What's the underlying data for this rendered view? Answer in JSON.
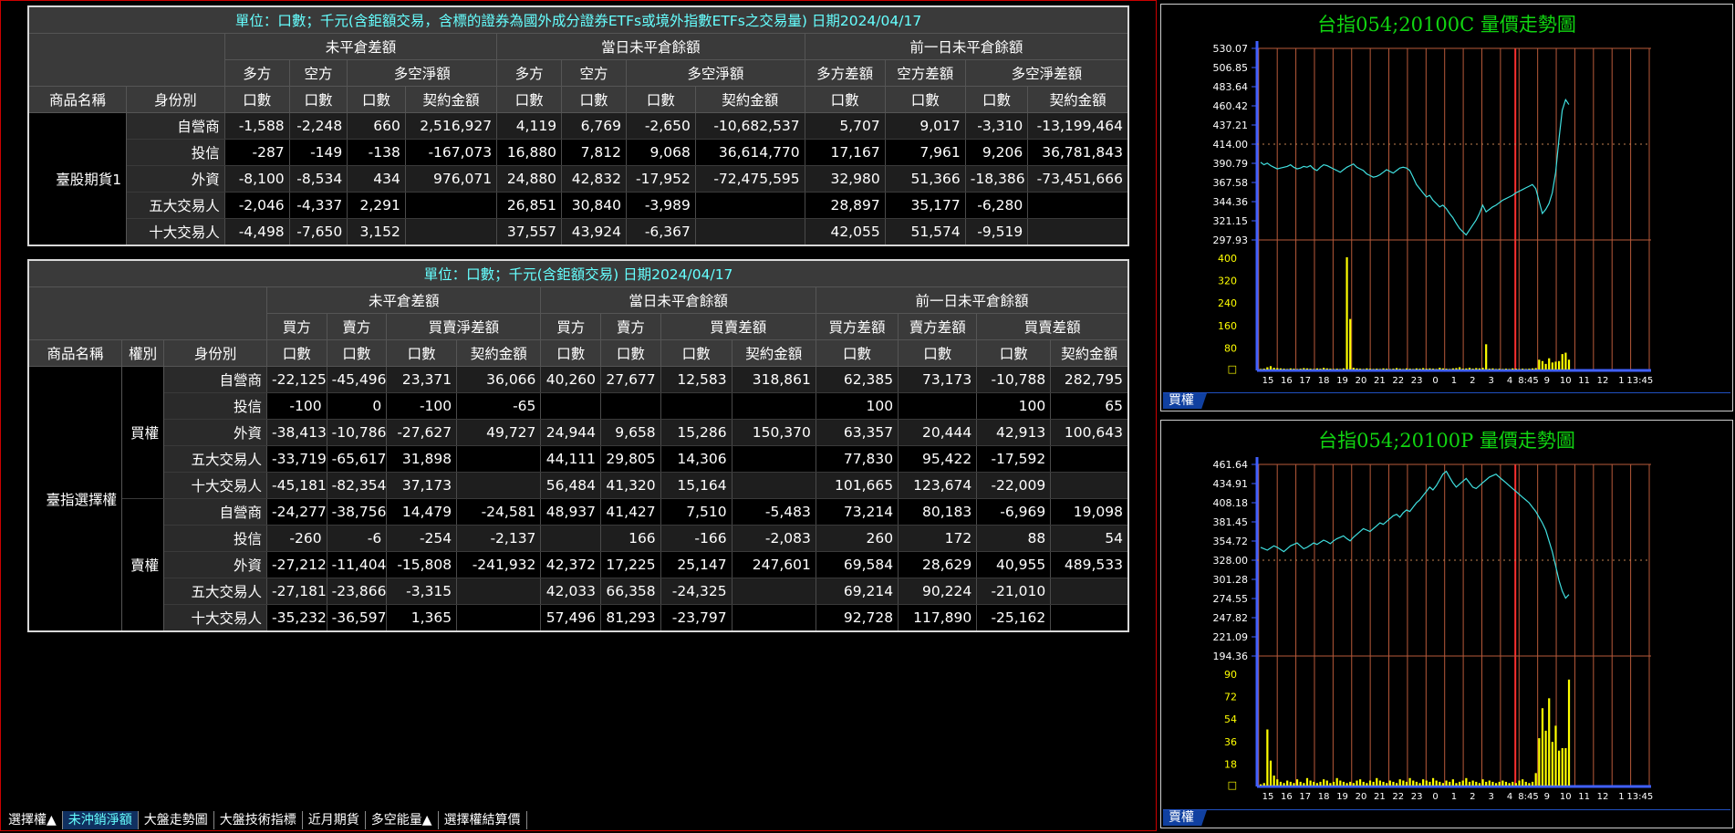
{
  "table1": {
    "title": "單位：口數；千元(含鉅額交易，含標的證券為國外成分證券ETFs或境外指數ETFs之交易量) 日期2024/04/17",
    "group_headers": [
      "未平倉差額",
      "當日未平倉餘額",
      "前一日未平倉餘額"
    ],
    "sub_headers": [
      "多方",
      "空方",
      "多空淨額",
      "多方",
      "空方",
      "多空淨額",
      "多方差額",
      "空方差額",
      "多空淨差額"
    ],
    "col_headers": [
      "商品名稱",
      "身份別",
      "口數",
      "口數",
      "口數",
      "契約金額",
      "口數",
      "口數",
      "口數",
      "契約金額",
      "口數",
      "口數",
      "口數",
      "契約金額"
    ],
    "product": "臺股期貨1",
    "rows": [
      {
        "id": "自營商",
        "v": [
          "-1,588",
          "-2,248",
          "660",
          "2,516,927",
          "4,119",
          "6,769",
          "-2,650",
          "-10,682,537",
          "5,707",
          "9,017",
          "-3,310",
          "-13,199,464"
        ]
      },
      {
        "id": "投信",
        "v": [
          "-287",
          "-149",
          "-138",
          "-167,073",
          "16,880",
          "7,812",
          "9,068",
          "36,614,770",
          "17,167",
          "7,961",
          "9,206",
          "36,781,843"
        ]
      },
      {
        "id": "外資",
        "v": [
          "-8,100",
          "-8,534",
          "434",
          "976,071",
          "24,880",
          "42,832",
          "-17,952",
          "-72,475,595",
          "32,980",
          "51,366",
          "-18,386",
          "-73,451,666"
        ]
      },
      {
        "id": "五大交易人",
        "v": [
          "-2,046",
          "-4,337",
          "2,291",
          "",
          "26,851",
          "30,840",
          "-3,989",
          "",
          "28,897",
          "35,177",
          "-6,280",
          ""
        ]
      },
      {
        "id": "十大交易人",
        "v": [
          "-4,498",
          "-7,650",
          "3,152",
          "",
          "37,557",
          "43,924",
          "-6,367",
          "",
          "42,055",
          "51,574",
          "-9,519",
          ""
        ]
      }
    ]
  },
  "table2": {
    "title": "單位：口數；千元(含鉅額交易) 日期2024/04/17",
    "group_headers": [
      "未平倉差額",
      "當日未平倉餘額",
      "前一日未平倉餘額"
    ],
    "sub_headers": [
      "買方",
      "賣方",
      "買賣淨差額",
      "買方",
      "賣方",
      "買賣差額",
      "買方差額",
      "賣方差額",
      "買賣差額"
    ],
    "col_headers": [
      "商品名稱",
      "權別",
      "身份別",
      "口數",
      "口數",
      "口數",
      "契約金額",
      "口數",
      "口數",
      "口數",
      "契約金額",
      "口數",
      "口數",
      "口數",
      "契約金額"
    ],
    "product": "臺指選擇權",
    "kinds": [
      "買權",
      "賣權"
    ],
    "rows": [
      {
        "id": "自營商",
        "v": [
          "-22,125",
          "-45,496",
          "23,371",
          "36,066",
          "40,260",
          "27,677",
          "12,583",
          "318,861",
          "62,385",
          "73,173",
          "-10,788",
          "282,795"
        ]
      },
      {
        "id": "投信",
        "v": [
          "-100",
          "0",
          "-100",
          "-65",
          "",
          "",
          "",
          "",
          "100",
          "",
          "100",
          "65"
        ]
      },
      {
        "id": "外資",
        "v": [
          "-38,413",
          "-10,786",
          "-27,627",
          "49,727",
          "24,944",
          "9,658",
          "15,286",
          "150,370",
          "63,357",
          "20,444",
          "42,913",
          "100,643"
        ]
      },
      {
        "id": "五大交易人",
        "v": [
          "-33,719",
          "-65,617",
          "31,898",
          "",
          "44,111",
          "29,805",
          "14,306",
          "",
          "77,830",
          "95,422",
          "-17,592",
          ""
        ]
      },
      {
        "id": "十大交易人",
        "v": [
          "-45,181",
          "-82,354",
          "37,173",
          "",
          "56,484",
          "41,320",
          "15,164",
          "",
          "101,665",
          "123,674",
          "-22,009",
          ""
        ]
      },
      {
        "id": "自營商",
        "v": [
          "-24,277",
          "-38,756",
          "14,479",
          "-24,581",
          "48,937",
          "41,427",
          "7,510",
          "-5,483",
          "73,214",
          "80,183",
          "-6,969",
          "19,098"
        ]
      },
      {
        "id": "投信",
        "v": [
          "-260",
          "-6",
          "-254",
          "-2,137",
          "",
          "166",
          "-166",
          "-2,083",
          "260",
          "172",
          "88",
          "54"
        ]
      },
      {
        "id": "外資",
        "v": [
          "-27,212",
          "-11,404",
          "-15,808",
          "-241,932",
          "42,372",
          "17,225",
          "25,147",
          "247,601",
          "69,584",
          "28,629",
          "40,955",
          "489,533"
        ]
      },
      {
        "id": "五大交易人",
        "v": [
          "-27,181",
          "-23,866",
          "-3,315",
          "",
          "42,033",
          "66,358",
          "-24,325",
          "",
          "69,214",
          "90,224",
          "-21,010",
          ""
        ]
      },
      {
        "id": "十大交易人",
        "v": [
          "-35,232",
          "-36,597",
          "1,365",
          "",
          "57,496",
          "81,293",
          "-23,797",
          "",
          "92,728",
          "117,890",
          "-25,162",
          ""
        ]
      }
    ]
  },
  "tabs": [
    "選擇權▲",
    "未沖銷淨額",
    "大盤走勢圖",
    "大盤技術指標",
    "近月期貨",
    "多空能量▲",
    "選擇權結算價"
  ],
  "active_tab": 1,
  "chart_data": [
    {
      "type": "line",
      "title": "台指054;20100C  量價走勢圖",
      "tab_label": "買權",
      "price_ticks": [
        "530.07",
        "506.85",
        "483.64",
        "460.42",
        "437.21",
        "414.00",
        "390.79",
        "367.58",
        "344.36",
        "321.15",
        "297.93"
      ],
      "price_range": [
        297.93,
        530.07
      ],
      "ref_price": 414.0,
      "volume_ticks": [
        "400",
        "320",
        "240",
        "160",
        "80",
        "□"
      ],
      "volume_range": [
        0,
        400
      ],
      "time_ticks": [
        "15",
        "16",
        "17",
        "18",
        "19",
        "20",
        "21",
        "22",
        "23",
        "0",
        "1",
        "2",
        "3",
        "4",
        "8:45",
        "9",
        "10",
        "11",
        "12",
        "1",
        "13:45"
      ],
      "price": [
        392,
        389,
        391,
        388,
        386,
        384,
        385,
        386,
        387,
        389,
        386,
        384,
        385,
        387,
        386,
        388,
        384,
        382,
        386,
        389,
        388,
        386,
        384,
        382,
        380,
        383,
        386,
        388,
        390,
        386,
        384,
        382,
        378,
        376,
        374,
        375,
        377,
        380,
        383,
        381,
        379,
        382,
        385,
        386,
        385,
        382,
        374,
        365,
        360,
        355,
        350,
        352,
        346,
        342,
        338,
        340,
        336,
        330,
        325,
        318,
        312,
        308,
        304,
        310,
        316,
        322,
        330,
        340,
        332,
        335,
        338,
        340,
        343,
        346,
        348,
        350,
        352,
        355,
        357,
        359,
        361,
        363,
        365,
        360,
        345,
        330,
        335,
        342,
        355,
        380,
        420,
        455,
        468,
        462
      ],
      "volume": [
        2,
        3,
        8,
        12,
        6,
        5,
        4,
        3,
        2,
        4,
        3,
        2,
        3,
        5,
        4,
        3,
        2,
        4,
        3,
        6,
        4,
        3,
        2,
        3,
        2,
        4,
        400,
        180,
        6,
        4,
        3,
        2,
        4,
        3,
        2,
        3,
        2,
        4,
        3,
        2,
        3,
        5,
        3,
        2,
        4,
        3,
        2,
        4,
        3,
        5,
        3,
        4,
        3,
        2,
        6,
        4,
        3,
        2,
        4,
        5,
        8,
        3,
        4,
        6,
        3,
        5,
        4,
        6,
        90,
        3,
        4,
        2,
        3,
        2,
        3,
        2,
        4,
        3,
        2,
        3,
        2,
        3,
        4,
        5,
        35,
        30,
        20,
        40,
        25,
        28,
        30,
        55,
        60,
        35
      ]
    },
    {
      "type": "line",
      "title": "台指054;20100P  量價走勢圖",
      "tab_label": "賣權",
      "price_ticks": [
        "461.64",
        "434.91",
        "408.18",
        "381.45",
        "354.72",
        "328.00",
        "301.28",
        "274.55",
        "247.82",
        "221.09",
        "194.36"
      ],
      "price_range": [
        194.36,
        461.64
      ],
      "ref_price": 328.0,
      "volume_ticks": [
        "90",
        "72",
        "54",
        "36",
        "18",
        "□"
      ],
      "volume_range": [
        0,
        90
      ],
      "time_ticks": [
        "15",
        "16",
        "17",
        "18",
        "19",
        "20",
        "21",
        "22",
        "23",
        "0",
        "1",
        "2",
        "3",
        "4",
        "8:45",
        "9",
        "10",
        "11",
        "12",
        "1",
        "13:45"
      ],
      "price": [
        346,
        344,
        342,
        345,
        348,
        346,
        343,
        340,
        344,
        348,
        350,
        352,
        348,
        344,
        346,
        349,
        352,
        350,
        353,
        356,
        354,
        351,
        355,
        358,
        360,
        362,
        358,
        355,
        360,
        364,
        368,
        372,
        370,
        368,
        372,
        376,
        380,
        378,
        382,
        386,
        390,
        392,
        388,
        394,
        398,
        396,
        402,
        408,
        412,
        418,
        424,
        430,
        426,
        432,
        440,
        448,
        452,
        444,
        436,
        430,
        434,
        438,
        442,
        436,
        430,
        428,
        432,
        436,
        440,
        444,
        446,
        448,
        444,
        440,
        436,
        432,
        428,
        424,
        420,
        416,
        412,
        408,
        402,
        396,
        388,
        380,
        370,
        355,
        340,
        320,
        300,
        285,
        275,
        280
      ],
      "volume": [
        1,
        2,
        45,
        20,
        8,
        5,
        3,
        2,
        4,
        3,
        2,
        5,
        3,
        2,
        6,
        4,
        3,
        2,
        3,
        5,
        4,
        2,
        3,
        6,
        4,
        3,
        2,
        3,
        2,
        4,
        5,
        3,
        2,
        4,
        3,
        6,
        4,
        3,
        2,
        4,
        3,
        2,
        5,
        4,
        3,
        6,
        4,
        3,
        2,
        5,
        4,
        3,
        6,
        4,
        3,
        2,
        4,
        3,
        5,
        2,
        3,
        4,
        6,
        3,
        4,
        3,
        2,
        5,
        3,
        4,
        3,
        2,
        3,
        4,
        3,
        2,
        3,
        2,
        4,
        5,
        3,
        2,
        3,
        10,
        38,
        62,
        44,
        70,
        35,
        48,
        28,
        30,
        30,
        85
      ]
    }
  ]
}
